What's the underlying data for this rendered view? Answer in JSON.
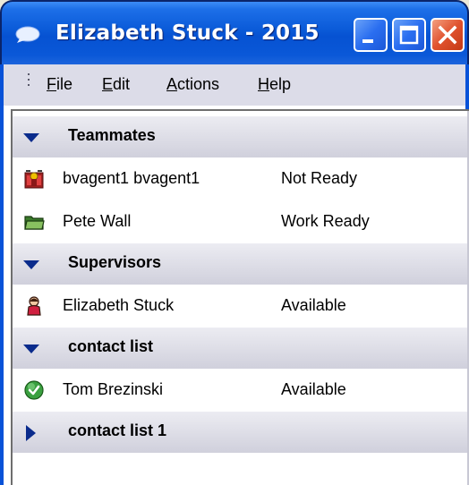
{
  "window": {
    "title": "Elizabeth Stuck - 2015",
    "title_icon": "chat-bubble-icon",
    "controls": [
      "minimize",
      "maximize",
      "close"
    ],
    "colors": {
      "titlebar": "#0a5ad8",
      "close_button": "#e0522e",
      "frame": "#0852d8",
      "group_header": "#d0d0dc"
    }
  },
  "menu": {
    "items": [
      {
        "mnemonic": "F",
        "rest": "ile"
      },
      {
        "mnemonic": "E",
        "rest": "dit"
      },
      {
        "mnemonic": "A",
        "rest": "ctions"
      },
      {
        "mnemonic": "H",
        "rest": "elp"
      }
    ]
  },
  "groups": [
    {
      "label": "Teammates",
      "expanded": true,
      "contacts": [
        {
          "name": "bvagent1 bvagent1",
          "status": "Not Ready",
          "icon": "not-ready-status-icon"
        },
        {
          "name": "Pete Wall",
          "status": "Work Ready",
          "icon": "work-ready-folder-icon"
        }
      ]
    },
    {
      "label": "Supervisors",
      "expanded": true,
      "contacts": [
        {
          "name": "Elizabeth Stuck",
          "status": "Available",
          "icon": "supervisor-person-icon"
        }
      ]
    },
    {
      "label": "contact list",
      "expanded": true,
      "contacts": [
        {
          "name": "Tom Brezinski",
          "status": "Available",
          "icon": "available-check-icon"
        }
      ]
    },
    {
      "label": "contact list 1",
      "expanded": false,
      "contacts": []
    }
  ]
}
